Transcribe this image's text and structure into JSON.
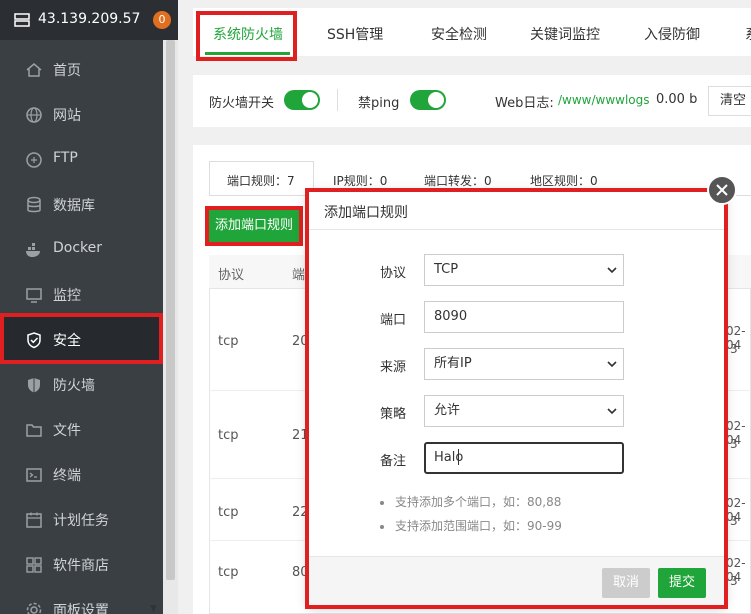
{
  "sidebar": {
    "server_ip": "43.139.209.57",
    "badge_count": "0",
    "items": [
      {
        "label": "首页",
        "icon": "home-icon"
      },
      {
        "label": "网站",
        "icon": "globe-icon"
      },
      {
        "label": "FTP",
        "icon": "ftp-icon"
      },
      {
        "label": "数据库",
        "icon": "database-icon"
      },
      {
        "label": "Docker",
        "icon": "docker-icon"
      },
      {
        "label": "监控",
        "icon": "monitor-icon"
      },
      {
        "label": "安全",
        "icon": "shield-check-icon",
        "active": true
      },
      {
        "label": "防火墙",
        "icon": "shield-icon"
      },
      {
        "label": "文件",
        "icon": "folder-icon"
      },
      {
        "label": "终端",
        "icon": "terminal-icon"
      },
      {
        "label": "计划任务",
        "icon": "calendar-icon"
      },
      {
        "label": "软件商店",
        "icon": "grid-icon"
      },
      {
        "label": "面板设置",
        "icon": "settings-icon"
      }
    ]
  },
  "top_tabs": [
    {
      "label": "系统防火墙",
      "active": true
    },
    {
      "label": "SSH管理"
    },
    {
      "label": "安全检测"
    },
    {
      "label": "关键词监控"
    },
    {
      "label": "入侵防御"
    },
    {
      "label": "系"
    }
  ],
  "firewall_bar": {
    "firewall_switch_label": "防火墙开关",
    "ping_label": "禁ping",
    "web_log_label": "Web日志:",
    "web_log_path": "/www/wwwlogs",
    "web_log_size": "0.00 b",
    "clear_label": "清空"
  },
  "sub_tabs": [
    {
      "label": "端口规则：7",
      "active": true
    },
    {
      "label": "IP规则：0"
    },
    {
      "label": "端口转发：0"
    },
    {
      "label": "地区规则：0"
    }
  ],
  "add_rule_button": "添加端口规则",
  "table": {
    "headers": [
      "协议",
      "端"
    ],
    "rows": [
      {
        "protocol": "tcp",
        "port": "20",
        "date": "02-04",
        "n": "3"
      },
      {
        "protocol": "tcp",
        "port": "21",
        "date": "02-04",
        "n": "3"
      },
      {
        "protocol": "tcp",
        "port": "22",
        "date": "02-04",
        "n": "3"
      },
      {
        "protocol": "tcp",
        "port": "80",
        "date": "02-04",
        "n": "3"
      }
    ]
  },
  "dialog": {
    "title": "添加端口规则",
    "fields": {
      "protocol_label": "协议",
      "protocol_value": "TCP",
      "port_label": "端口",
      "port_value": "8090",
      "source_label": "来源",
      "source_value": "所有IP",
      "policy_label": "策略",
      "policy_value": "允许",
      "remark_label": "备注",
      "remark_value": "Halo"
    },
    "hints": [
      "支持添加多个端口，如：80,88",
      "支持添加范围端口，如：90-99"
    ],
    "cancel_label": "取消",
    "submit_label": "提交"
  },
  "colors": {
    "accent": "#20a53a",
    "highlight": "#e02020",
    "sidebar_bg": "#3a3f44"
  }
}
